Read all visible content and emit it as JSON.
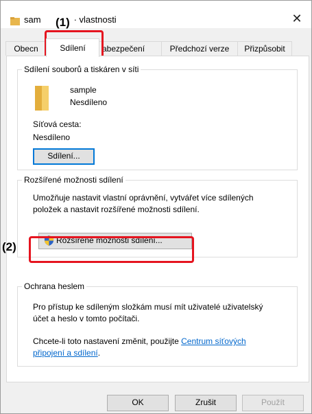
{
  "window": {
    "title_prefix": "sam",
    "title_suffix": "· vlastnosti",
    "close_glyph": "✕"
  },
  "tabs": [
    {
      "label": "Obecn"
    },
    {
      "label": "Sdílení",
      "active": true
    },
    {
      "label": "abezpečení"
    },
    {
      "label": "Předchozí verze"
    },
    {
      "label": "Přizpůsobit"
    }
  ],
  "sharing": {
    "group_title": "Sdílení souborů a tiskáren v síti",
    "folder_name": "sample",
    "folder_status": "Nesdíleno",
    "network_path_label": "Síťová cesta:",
    "network_path_value": "Nesdíleno",
    "share_button": "Sdílení..."
  },
  "advanced": {
    "group_title": "Rozšířené možnosti sdílení",
    "description_line1": "Umožňuje nastavit vlastní oprávnění, vytvářet více sdílených",
    "description_line2": "položek a nastavit rozšířené možnosti sdílení.",
    "button": "Rozšířené možnosti sdílení..."
  },
  "password": {
    "group_title": "Ochrana heslem",
    "line1": "Pro přístup ke sdíleným složkám musí mít uživatelé uživatelský",
    "line2": "účet a heslo v tomto počítači.",
    "change_text": "Chcete-li toto nastavení změnit, použijte ",
    "link_part1": "Centrum síťových",
    "link_part2": "připojení a sdílení",
    "end_period": "."
  },
  "footer": {
    "ok": "OK",
    "cancel": "Zrušit",
    "apply": "Použít"
  },
  "callouts": {
    "one": "(1)",
    "two": "(2)"
  },
  "colors": {
    "callout": "#e5141f",
    "link": "#0066cc",
    "focus": "#0078d7"
  }
}
